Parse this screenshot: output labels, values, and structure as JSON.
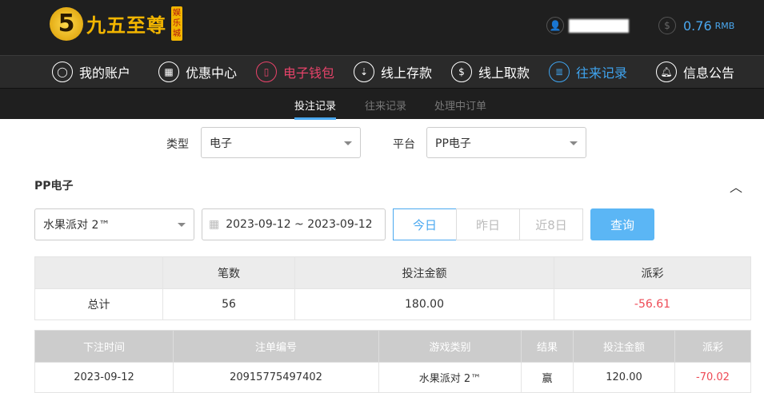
{
  "header": {
    "logo_text": "九五至尊",
    "logo_badge": "娱乐城",
    "logo_digit": "5",
    "balance": "0.76",
    "currency": "RMB"
  },
  "nav": [
    {
      "label": "我的账户"
    },
    {
      "label": "优惠中心"
    },
    {
      "label": "电子钱包"
    },
    {
      "label": "线上存款"
    },
    {
      "label": "线上取款"
    },
    {
      "label": "往来记录"
    },
    {
      "label": "信息公告"
    }
  ],
  "subnav": [
    "投注记录",
    "往来记录",
    "处理中订单"
  ],
  "filters": {
    "type_label": "类型",
    "type_value": "电子",
    "platform_label": "平台",
    "platform_value": "PP电子"
  },
  "section_title": "PP电子",
  "query": {
    "game": "水果派对 2™",
    "date_range": "2023-09-12 ~ 2023-09-12",
    "today": "今日",
    "yesterday": "昨日",
    "last8": "近8日",
    "search": "查询"
  },
  "summary": {
    "headers": [
      "",
      "笔数",
      "投注金额",
      "派彩"
    ],
    "row": [
      "总计",
      "56",
      "180.00",
      "-56.61"
    ]
  },
  "records": {
    "headers": [
      "下注时间",
      "注单编号",
      "游戏类别",
      "结果",
      "投注金额",
      "派彩"
    ],
    "rows": [
      [
        "2023-09-12",
        "20915775497402",
        "水果派对 2™",
        "赢",
        "120.00",
        "-70.02"
      ]
    ]
  }
}
